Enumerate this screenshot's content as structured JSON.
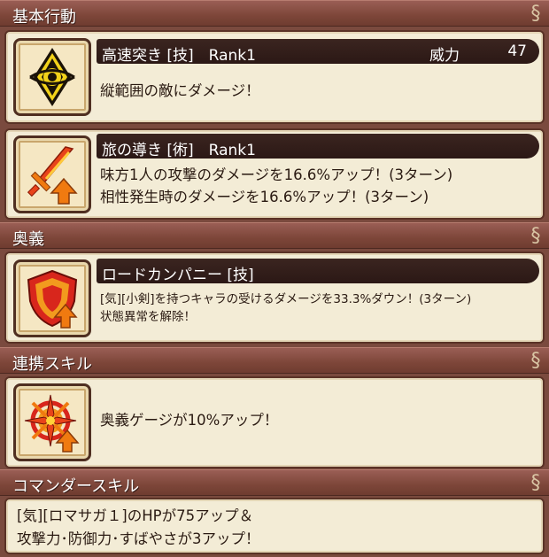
{
  "sections": {
    "basic": {
      "title": "基本行動"
    },
    "ougi": {
      "title": "奥義"
    },
    "link": {
      "title": "連携スキル"
    },
    "commander": {
      "title": "コマンダースキル"
    }
  },
  "skills": [
    {
      "name": "高速突き [技]　Rank1",
      "power_label": "威力",
      "power_value": "47",
      "lines": [
        "縦範囲の敵にダメージ！"
      ],
      "icon": "eye-diamond-icon"
    },
    {
      "name": "旅の導き [術]　Rank1",
      "lines": [
        "味方1人の攻撃のダメージを16.6%アップ！(3ターン)",
        "相性発生時のダメージを16.6%アップ！(3ターン)"
      ],
      "icon": "flame-sword-up-icon"
    }
  ],
  "ougi_skill": {
    "name": "ロードカンパニー [技]",
    "lines": [
      "[気][小剣]を持つキャラの受けるダメージを33.3%ダウン！(3ターン)",
      "状態異常を解除！"
    ],
    "icon": "shield-up-icon"
  },
  "link_skill": {
    "lines": [
      "奥義ゲージが10%アップ！"
    ],
    "icon": "star-burst-up-icon"
  },
  "commander_skill": {
    "lines": [
      "[気][ロマサガ１]のHPが75アップ＆",
      "攻撃力･防御力･すばやさが3アップ！"
    ]
  },
  "colors": {
    "header_bg": "#7d4639",
    "card_bg": "#f3ecd6",
    "bar_bg": "#2b1815",
    "icon_yellow": "#f2d21a",
    "icon_orange": "#f07a10",
    "icon_red": "#d8261c"
  }
}
